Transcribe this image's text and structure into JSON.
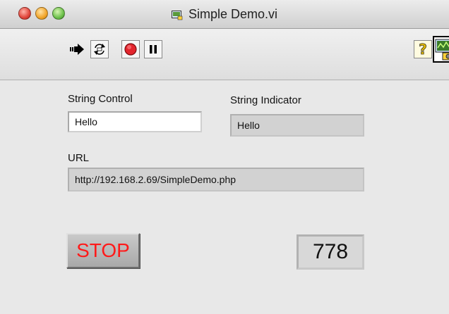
{
  "window": {
    "title": "Simple Demo.vi"
  },
  "toolbar": {
    "icons": [
      "run-arrow-icon",
      "run-continuously-icon",
      "abort-icon",
      "pause-icon",
      "help-icon",
      "vi-connector-icon"
    ],
    "help_glyph": "?"
  },
  "front_panel": {
    "string_control": {
      "label": "String Control",
      "value": "Hello"
    },
    "string_indicator": {
      "label": "String Indicator",
      "value": "Hello"
    },
    "url": {
      "label": "URL",
      "value": "http://192.168.2.69/SimpleDemo.php"
    },
    "stop_button": {
      "label": "STOP"
    },
    "numeric_indicator": {
      "value": "778"
    }
  },
  "colors": {
    "stop_text": "#ff1a1a",
    "panel_background": "#e8e8e8"
  }
}
